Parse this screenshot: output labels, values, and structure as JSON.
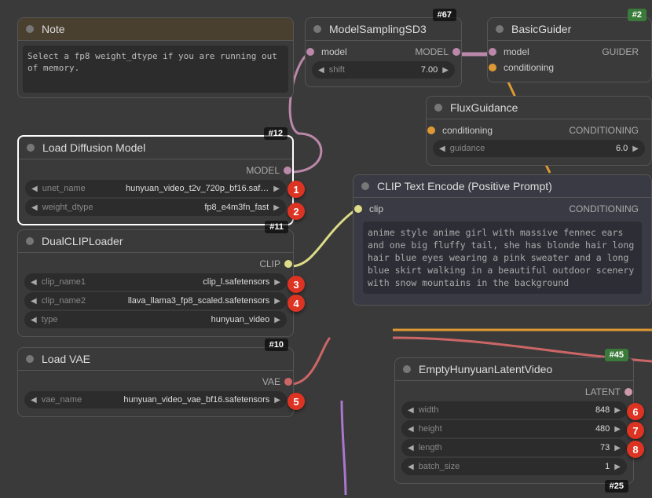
{
  "nodes": {
    "note": {
      "title": "Note",
      "text": "Select a fp8 weight_dtype if you are running out of memory."
    },
    "loadDiffusion": {
      "badge": "#12",
      "title": "Load Diffusion Model",
      "output": "MODEL",
      "unet_name_label": "unet_name",
      "unet_name_value": "hunyuan_video_t2v_720p_bf16.saf…",
      "weight_dtype_label": "weight_dtype",
      "weight_dtype_value": "fp8_e4m3fn_fast"
    },
    "dualClip": {
      "badge": "#11",
      "title": "DualCLIPLoader",
      "output": "CLIP",
      "clip1_label": "clip_name1",
      "clip1_value": "clip_l.safetensors",
      "clip2_label": "clip_name2",
      "clip2_value": "llava_llama3_fp8_scaled.safetensors",
      "type_label": "type",
      "type_value": "hunyuan_video"
    },
    "loadVae": {
      "badge": "#10",
      "title": "Load VAE",
      "output": "VAE",
      "vae_label": "vae_name",
      "vae_value": "hunyuan_video_vae_bf16.safetensors"
    },
    "modelSampling": {
      "badge": "#67",
      "title": "ModelSamplingSD3",
      "in_model": "model",
      "out_model": "MODEL",
      "shift_label": "shift",
      "shift_value": "7.00"
    },
    "basicGuider": {
      "badge": "#2",
      "title": "BasicGuider",
      "in_model": "model",
      "in_cond": "conditioning",
      "out": "GUIDER"
    },
    "fluxGuidance": {
      "title": "FluxGuidance",
      "in_cond": "conditioning",
      "out_cond": "CONDITIONING",
      "guidance_label": "guidance",
      "guidance_value": "6.0"
    },
    "clipEncode": {
      "title": "CLIP Text Encode (Positive Prompt)",
      "in_clip": "clip",
      "out_cond": "CONDITIONING",
      "prompt": "anime style anime girl with massive fennec ears and one big fluffy tail, she has blonde hair long hair blue eyes wearing a pink sweater and a long blue skirt walking in a beautiful outdoor scenery with snow mountains in the background"
    },
    "emptyLatent": {
      "badge": "#45",
      "title": "EmptyHunyuanLatentVideo",
      "out": "LATENT",
      "width_label": "width",
      "width_value": "848",
      "height_label": "height",
      "height_value": "480",
      "length_label": "length",
      "length_value": "73",
      "batch_label": "batch_size",
      "batch_value": "1",
      "bottom_badge": "#25"
    }
  },
  "markers": {
    "m1": "1",
    "m2": "2",
    "m3": "3",
    "m4": "4",
    "m5": "5",
    "m6": "6",
    "m7": "7",
    "m8": "8"
  }
}
